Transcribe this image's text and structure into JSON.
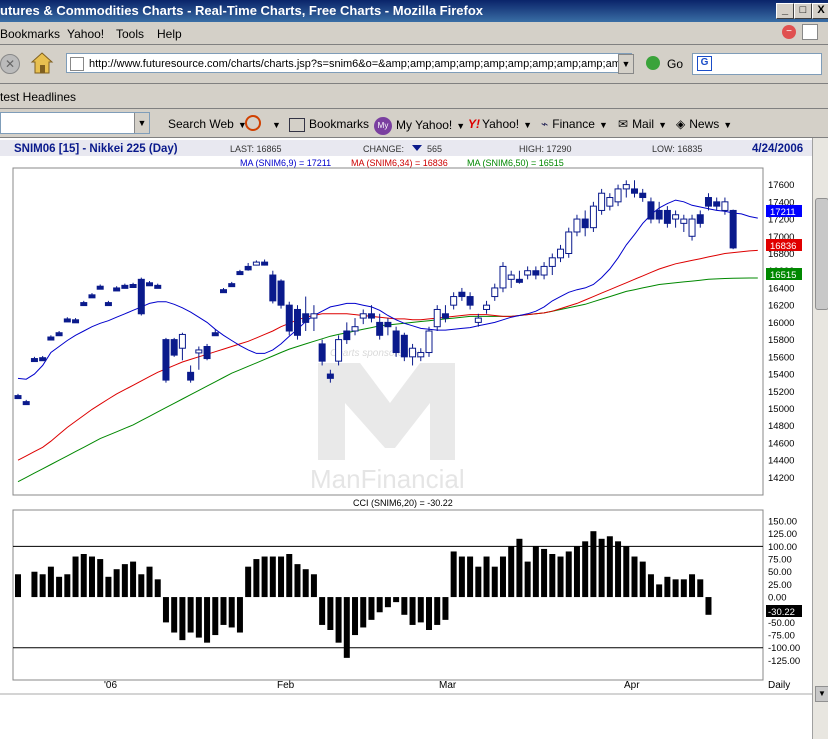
{
  "window": {
    "title": "utures & Commodities Charts - Real-Time Charts, Free Charts - Mozilla Firefox",
    "buttons": [
      "_",
      "□",
      "X"
    ]
  },
  "menu": [
    "Bookmarks",
    "Yahoo!",
    "Tools",
    "Help"
  ],
  "nav": {
    "url": "http://www.futuresource.com/charts/charts.jsp?s=snim6&o=&amp;amp;amp;amp;amp;amp;amp;amp;amp;amp;a",
    "go_label": "Go"
  },
  "headlines": {
    "label": "test Headlines"
  },
  "yahoo_toolbar": {
    "search_web": "Search Web",
    "bookmarks": "Bookmarks",
    "my_yahoo": "My Yahoo!",
    "my_badge": "My",
    "yahoo": "Yahoo!",
    "yahoo_badge": "Y!",
    "finance": "Finance",
    "mail": "Mail",
    "news": "News"
  },
  "chart_header": {
    "symbol": "SNIM06 [15] - Nikkei 225 (Day)",
    "last": "LAST: 16865",
    "change_label": "CHANGE:",
    "change_value": "565",
    "high": "HIGH: 17290",
    "low": "LOW: 16835",
    "date": "4/24/2006",
    "ma_fast": "MA (SNIM6,9) = 17211",
    "ma_mid": "MA (SNIM6,34) = 16836",
    "ma_slow": "MA (SNIM6,50) = 16515"
  },
  "watermark": {
    "sponsor": "Charts sponsored by:",
    "brand": "ManFinancial"
  },
  "price_badges": {
    "ma_fast": "17211",
    "ma_mid": "16836",
    "ma_slow": "16515"
  },
  "cci_badge": "-30.22",
  "x_axis": {
    "labels": [
      "'06",
      "Feb",
      "Mar",
      "Apr"
    ],
    "period": "Daily"
  },
  "colors": {
    "candle": "#0a1a8c",
    "ma_fast": "#0000cc",
    "ma_mid": "#dd0000",
    "ma_slow": "#008800",
    "badge_fast": "#0000ff",
    "badge_mid": "#e00000",
    "badge_slow": "#008800"
  },
  "chart_data": [
    {
      "type": "candlestick",
      "title": "SNIM06 [15] - Nikkei 225 (Day)",
      "y_ticks": [
        14200,
        14400,
        14600,
        14800,
        15000,
        15200,
        15400,
        15600,
        15800,
        16000,
        16200,
        16400,
        16600,
        16800,
        17000,
        17200,
        17400,
        17600
      ],
      "ylim": [
        14100,
        17700
      ],
      "candles": [
        {
          "o": 15150,
          "h": 15170,
          "l": 15140,
          "c": 15150
        },
        {
          "o": 15080,
          "h": 15100,
          "l": 15060,
          "c": 15080
        },
        {
          "o": 15580,
          "h": 15600,
          "l": 15560,
          "c": 15580
        },
        {
          "o": 15590,
          "h": 15610,
          "l": 15570,
          "c": 15590
        },
        {
          "o": 15830,
          "h": 15850,
          "l": 15810,
          "c": 15830
        },
        {
          "o": 15880,
          "h": 15900,
          "l": 15860,
          "c": 15880
        },
        {
          "o": 16040,
          "h": 16060,
          "l": 16020,
          "c": 16040
        },
        {
          "o": 16030,
          "h": 16050,
          "l": 16010,
          "c": 16030
        },
        {
          "o": 16230,
          "h": 16250,
          "l": 16210,
          "c": 16230
        },
        {
          "o": 16320,
          "h": 16340,
          "l": 16300,
          "c": 16320
        },
        {
          "o": 16420,
          "h": 16440,
          "l": 16400,
          "c": 16420
        },
        {
          "o": 16230,
          "h": 16250,
          "l": 16210,
          "c": 16230
        },
        {
          "o": 16400,
          "h": 16420,
          "l": 16380,
          "c": 16400
        },
        {
          "o": 16430,
          "h": 16450,
          "l": 16410,
          "c": 16430
        },
        {
          "o": 16440,
          "h": 16460,
          "l": 16420,
          "c": 16440
        },
        {
          "o": 16500,
          "h": 16520,
          "l": 16080,
          "c": 16100
        },
        {
          "o": 16460,
          "h": 16480,
          "l": 16440,
          "c": 16460
        },
        {
          "o": 16430,
          "h": 16450,
          "l": 16410,
          "c": 16430
        },
        {
          "o": 15800,
          "h": 15820,
          "l": 15300,
          "c": 15330
        },
        {
          "o": 15800,
          "h": 15820,
          "l": 15600,
          "c": 15620
        },
        {
          "o": 15700,
          "h": 15880,
          "l": 15560,
          "c": 15860
        },
        {
          "o": 15420,
          "h": 15500,
          "l": 15300,
          "c": 15330
        },
        {
          "o": 15650,
          "h": 15720,
          "l": 15450,
          "c": 15680
        },
        {
          "o": 15720,
          "h": 15750,
          "l": 15560,
          "c": 15580
        },
        {
          "o": 15880,
          "h": 15920,
          "l": 15860,
          "c": 15880
        },
        {
          "o": 16380,
          "h": 16400,
          "l": 16360,
          "c": 16380
        },
        {
          "o": 16450,
          "h": 16470,
          "l": 16430,
          "c": 16450
        },
        {
          "o": 16590,
          "h": 16610,
          "l": 16570,
          "c": 16590
        },
        {
          "o": 16650,
          "h": 16690,
          "l": 16600,
          "c": 16610
        },
        {
          "o": 16680,
          "h": 16720,
          "l": 16660,
          "c": 16700
        },
        {
          "o": 16700,
          "h": 16730,
          "l": 16660,
          "c": 16680
        },
        {
          "o": 16550,
          "h": 16600,
          "l": 16220,
          "c": 16250
        },
        {
          "o": 16480,
          "h": 16500,
          "l": 16160,
          "c": 16200
        },
        {
          "o": 16200,
          "h": 16240,
          "l": 15850,
          "c": 15900
        },
        {
          "o": 16150,
          "h": 16200,
          "l": 15800,
          "c": 15850
        },
        {
          "o": 16100,
          "h": 16300,
          "l": 15900,
          "c": 16000
        },
        {
          "o": 16050,
          "h": 16200,
          "l": 15900,
          "c": 16100
        },
        {
          "o": 15750,
          "h": 15800,
          "l": 15500,
          "c": 15550
        },
        {
          "o": 15400,
          "h": 15450,
          "l": 15300,
          "c": 15350
        },
        {
          "o": 15550,
          "h": 15850,
          "l": 15500,
          "c": 15800
        },
        {
          "o": 15900,
          "h": 16000,
          "l": 15750,
          "c": 15800
        },
        {
          "o": 15900,
          "h": 16050,
          "l": 15850,
          "c": 15950
        },
        {
          "o": 16050,
          "h": 16150,
          "l": 15980,
          "c": 16100
        },
        {
          "o": 16100,
          "h": 16200,
          "l": 16000,
          "c": 16050
        },
        {
          "o": 16000,
          "h": 16100,
          "l": 15800,
          "c": 15850
        },
        {
          "o": 16000,
          "h": 16050,
          "l": 15850,
          "c": 15950
        },
        {
          "o": 15900,
          "h": 15950,
          "l": 15600,
          "c": 15650
        },
        {
          "o": 15850,
          "h": 15880,
          "l": 15550,
          "c": 15600
        },
        {
          "o": 15600,
          "h": 15750,
          "l": 15500,
          "c": 15700
        },
        {
          "o": 15600,
          "h": 15700,
          "l": 15550,
          "c": 15650
        },
        {
          "o": 15650,
          "h": 15950,
          "l": 15600,
          "c": 15900
        },
        {
          "o": 15950,
          "h": 16200,
          "l": 15900,
          "c": 16150
        },
        {
          "o": 16100,
          "h": 16200,
          "l": 16000,
          "c": 16050
        },
        {
          "o": 16200,
          "h": 16350,
          "l": 16150,
          "c": 16300
        },
        {
          "o": 16350,
          "h": 16400,
          "l": 16250,
          "c": 16300
        },
        {
          "o": 16300,
          "h": 16350,
          "l": 16150,
          "c": 16200
        },
        {
          "o": 16000,
          "h": 16100,
          "l": 15950,
          "c": 16050
        },
        {
          "o": 16150,
          "h": 16250,
          "l": 16100,
          "c": 16200
        },
        {
          "o": 16300,
          "h": 16450,
          "l": 16250,
          "c": 16400
        },
        {
          "o": 16400,
          "h": 16700,
          "l": 16350,
          "c": 16650
        },
        {
          "o": 16500,
          "h": 16600,
          "l": 16400,
          "c": 16550
        },
        {
          "o": 16500,
          "h": 16600,
          "l": 16450,
          "c": 16500
        },
        {
          "o": 16550,
          "h": 16650,
          "l": 16500,
          "c": 16600
        },
        {
          "o": 16600,
          "h": 16650,
          "l": 16500,
          "c": 16550
        },
        {
          "o": 16550,
          "h": 16700,
          "l": 16500,
          "c": 16650
        },
        {
          "o": 16650,
          "h": 16800,
          "l": 16550,
          "c": 16750
        },
        {
          "o": 16750,
          "h": 16900,
          "l": 16700,
          "c": 16850
        },
        {
          "o": 16800,
          "h": 17100,
          "l": 16750,
          "c": 17050
        },
        {
          "o": 17050,
          "h": 17250,
          "l": 17000,
          "c": 17200
        },
        {
          "o": 17200,
          "h": 17300,
          "l": 17000,
          "c": 17100
        },
        {
          "o": 17100,
          "h": 17400,
          "l": 17050,
          "c": 17350
        },
        {
          "o": 17300,
          "h": 17550,
          "l": 17250,
          "c": 17500
        },
        {
          "o": 17350,
          "h": 17500,
          "l": 17300,
          "c": 17450
        },
        {
          "o": 17400,
          "h": 17600,
          "l": 17350,
          "c": 17550
        },
        {
          "o": 17550,
          "h": 17650,
          "l": 17450,
          "c": 17600
        },
        {
          "o": 17550,
          "h": 17650,
          "l": 17450,
          "c": 17500
        },
        {
          "o": 17500,
          "h": 17550,
          "l": 17400,
          "c": 17450
        },
        {
          "o": 17400,
          "h": 17450,
          "l": 17150,
          "c": 17200
        },
        {
          "o": 17300,
          "h": 17400,
          "l": 17150,
          "c": 17200
        },
        {
          "o": 17300,
          "h": 17350,
          "l": 17100,
          "c": 17150
        },
        {
          "o": 17200,
          "h": 17300,
          "l": 17100,
          "c": 17250
        },
        {
          "o": 17150,
          "h": 17250,
          "l": 17050,
          "c": 17200
        },
        {
          "o": 17000,
          "h": 17250,
          "l": 16950,
          "c": 17200
        },
        {
          "o": 17250,
          "h": 17300,
          "l": 17100,
          "c": 17150
        },
        {
          "o": 17450,
          "h": 17500,
          "l": 17300,
          "c": 17350
        },
        {
          "o": 17400,
          "h": 17450,
          "l": 17300,
          "c": 17350
        },
        {
          "o": 17300,
          "h": 17450,
          "l": 17250,
          "c": 17400
        },
        {
          "o": 17300,
          "h": 17310,
          "l": 16850,
          "c": 16865
        }
      ],
      "ma_fast": [
        15350,
        15340,
        15400,
        15500,
        15650,
        15720,
        15790,
        15850,
        15900,
        15950,
        15990,
        16020,
        16060,
        16100,
        16140,
        16180,
        16220,
        16240,
        16240,
        16210,
        16170,
        16120,
        16060,
        16000,
        15920,
        15850,
        15790,
        15730,
        15680,
        15640,
        15640,
        15680,
        15750,
        15840,
        15920,
        16010,
        16080,
        16130,
        16180,
        16200,
        16220,
        16220,
        16200,
        16180,
        16140,
        16080,
        16030,
        15990,
        15960,
        15930,
        15920,
        15910,
        15910,
        15920,
        15930,
        15940,
        15960,
        15980,
        16000,
        16030,
        16060,
        16080,
        16100,
        16130,
        16180,
        16250,
        16300,
        16350,
        16380,
        16400,
        16440,
        16520,
        16620,
        16750,
        16900,
        17020,
        17150,
        17250,
        17330,
        17380,
        17420,
        17400,
        17360,
        17340,
        17320,
        17300,
        17290,
        17270,
        17260,
        17230,
        17211
      ],
      "ma_mid": [
        14400,
        14450,
        14500,
        14550,
        14620,
        14700,
        14780,
        14850,
        14920,
        14990,
        15050,
        15110,
        15170,
        15220,
        15270,
        15320,
        15370,
        15420,
        15460,
        15500,
        15540,
        15570,
        15600,
        15630,
        15660,
        15690,
        15720,
        15750,
        15780,
        15820,
        15860,
        15900,
        15950,
        15990,
        16030,
        16060,
        16080,
        16100,
        16100,
        16100,
        16100,
        16090,
        16080,
        16070,
        16060,
        16050,
        16040,
        16040,
        16030,
        16030,
        16040,
        16050,
        16060,
        16070,
        16080,
        16090,
        16090,
        16090,
        16080,
        16070,
        16070,
        16080,
        16090,
        16100,
        16110,
        16130,
        16160,
        16190,
        16220,
        16260,
        16300,
        16340,
        16380,
        16420,
        16460,
        16500,
        16540,
        16580,
        16620,
        16650,
        16680,
        16700,
        16720,
        16740,
        16760,
        16780,
        16800,
        16810,
        16820,
        16830,
        16836
      ],
      "ma_slow": [
        14150,
        14200,
        14250,
        14300,
        14350,
        14400,
        14450,
        14500,
        14550,
        14600,
        14650,
        14690,
        14730,
        14770,
        14810,
        14860,
        14910,
        14960,
        15010,
        15060,
        15110,
        15160,
        15210,
        15260,
        15310,
        15360,
        15410,
        15450,
        15490,
        15530,
        15570,
        15610,
        15650,
        15690,
        15720,
        15750,
        15780,
        15810,
        15840,
        15860,
        15880,
        15900,
        15920,
        15940,
        15960,
        15970,
        15980,
        15990,
        16000,
        16010,
        16020,
        16030,
        16040,
        16050,
        16060,
        16070,
        16070,
        16070,
        16070,
        16070,
        16070,
        16080,
        16090,
        16100,
        16110,
        16130,
        16150,
        16170,
        16190,
        16210,
        16240,
        16270,
        16300,
        16330,
        16360,
        16380,
        16400,
        16420,
        16440,
        16450,
        16460,
        16470,
        16480,
        16490,
        16500,
        16505,
        16510,
        16512,
        16514,
        16515,
        16515
      ]
    },
    {
      "type": "bar",
      "title": "CCI (SNIM6,20) = -30.22",
      "y_ticks": [
        150,
        125,
        100,
        75,
        50,
        25,
        0,
        -25,
        -50,
        -75,
        -100,
        -125
      ],
      "ylim": [
        -140,
        160
      ],
      "values": [
        45,
        0,
        50,
        45,
        60,
        40,
        45,
        80,
        85,
        80,
        75,
        40,
        55,
        65,
        70,
        45,
        60,
        35,
        -50,
        -70,
        -85,
        -70,
        -80,
        -90,
        -75,
        -55,
        -60,
        -70,
        60,
        75,
        80,
        80,
        80,
        85,
        65,
        55,
        45,
        -55,
        -65,
        -90,
        -120,
        -75,
        -60,
        -45,
        -30,
        -20,
        -10,
        -35,
        -55,
        -50,
        -65,
        -55,
        -45,
        90,
        80,
        80,
        60,
        80,
        60,
        80,
        100,
        115,
        70,
        100,
        95,
        85,
        80,
        90,
        100,
        110,
        130,
        115,
        120,
        110,
        100,
        80,
        70,
        45,
        25,
        40,
        35,
        35,
        45,
        35,
        -35
      ]
    }
  ]
}
